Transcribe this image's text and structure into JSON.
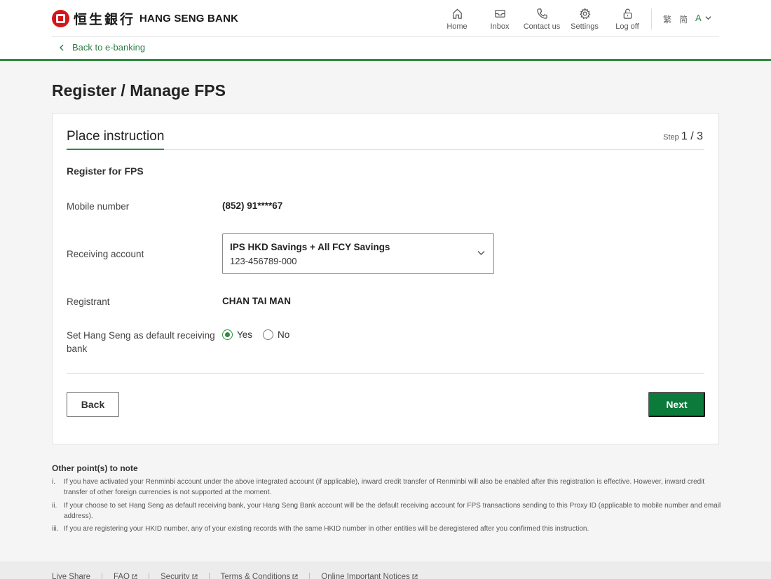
{
  "header": {
    "logo_cn": "恒生銀行",
    "logo_en": "HANG SENG BANK",
    "nav": [
      {
        "label": "Home",
        "icon": "home-icon"
      },
      {
        "label": "Inbox",
        "icon": "inbox-icon"
      },
      {
        "label": "Contact us",
        "icon": "phone-icon"
      },
      {
        "label": "Settings",
        "icon": "gear-icon"
      },
      {
        "label": "Log off",
        "icon": "lock-icon"
      }
    ],
    "lang_traditional": "繁",
    "lang_simplified": "简",
    "font_size_label": "A",
    "back_link": "Back to e-banking",
    "accent_color": "#2e8b3d"
  },
  "page": {
    "title": "Register / Manage FPS"
  },
  "card": {
    "title": "Place instruction",
    "step_prefix": "Step",
    "step_value": "1 / 3",
    "section_title": "Register for FPS",
    "mobile_label": "Mobile number",
    "mobile_value": "(852) 91****67",
    "account_label": "Receiving account",
    "account_name": "IPS HKD Savings + All FCY Savings",
    "account_number": "123-456789-000",
    "registrant_label": "Registrant",
    "registrant_value": "CHAN TAI MAN",
    "default_bank_label": "Set Hang Seng as default receiving bank",
    "option_yes": "Yes",
    "option_no": "No",
    "selected_option": "Yes",
    "back_button": "Back",
    "next_button": "Next",
    "next_button_color": "#0b7a3a"
  },
  "notes": {
    "title": "Other point(s) to note",
    "items": [
      {
        "num": "i.",
        "text": "If you have activated your Renminbi account under the above integrated account (if applicable), inward credit transfer of Renminbi will also be enabled after this registration is effective. However, inward credit transfer of other foreign currencies is not supported at the moment."
      },
      {
        "num": "ii.",
        "text": "If your choose to set Hang Seng as default receiving bank, your Hang Seng Bank account will be the default receiving account for FPS transactions sending to this Proxy ID (applicable to mobile number and email address)."
      },
      {
        "num": "iii.",
        "text": "If you are registering your HKID number, any of your existing records with the same HKID number in other entities will be deregistered after you confirmed this instruction."
      }
    ]
  },
  "footer": {
    "links": [
      "Live Share",
      "FAQ",
      "Security",
      "Terms & Conditions",
      "Online Important Notices"
    ]
  }
}
